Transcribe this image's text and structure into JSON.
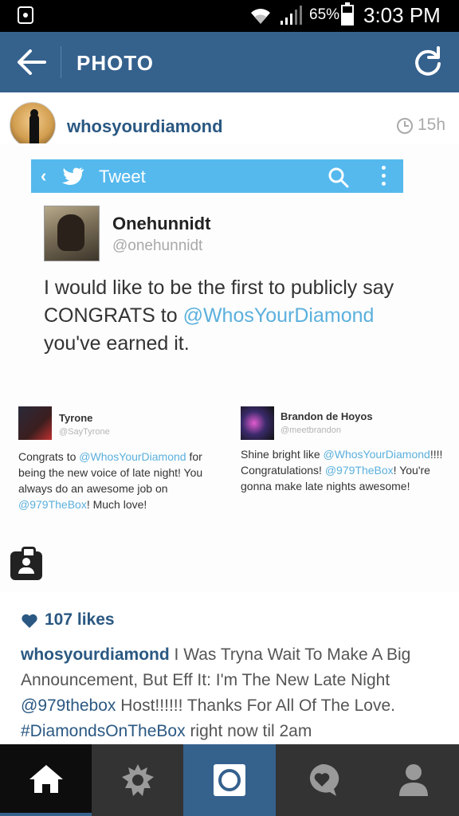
{
  "status_bar": {
    "battery_percent": "65%",
    "time": "3:03 PM",
    "icons": [
      "notification-icon",
      "wifi-icon",
      "signal-icon",
      "battery-icon"
    ]
  },
  "header": {
    "title": "PHOTO",
    "back_icon": "arrow-left-icon",
    "refresh_icon": "refresh-icon"
  },
  "post": {
    "username": "whosyourdiamond",
    "time_ago": "15h"
  },
  "photo": {
    "tweet_bar": {
      "title": "Tweet"
    },
    "tweet": {
      "name": "Onehunnidt",
      "handle": "@onehunnidt",
      "text_before": "I would like to be the first to publicly say CONGRATS to ",
      "mention": "@WhosYourDiamond",
      "text_after": " you've earned it."
    },
    "replies": [
      {
        "name": "Tyrone",
        "handle": "@SayTyrone",
        "t1": "Congrats to ",
        "m1": "@WhosYourDiamond",
        "t2": " for being the new voice of late night! You always do an awesome job on ",
        "m2": "@979TheBox",
        "t3": "! Much love!"
      },
      {
        "name": "Brandon de Hoyos",
        "handle": "@meetbrandon",
        "t1": "Shine bright like ",
        "m1": "@WhosYourDiamond",
        "t2": "!!!! Congratulations! ",
        "m2": "@979TheBox",
        "t3": "! You're gonna make late nights awesome!"
      }
    ]
  },
  "likes": {
    "text": "107 likes"
  },
  "caption": {
    "username": "whosyourdiamond",
    "text1": " I Was Tryna Wait To Make A Big Announcement, But Eff It: I'm The New Late Night ",
    "mention": "@979thebox",
    "text2": " Host!!!!!! Thanks For All Of The Love. ",
    "hashtag": "#DiamondsOnTheBox",
    "text3": " right now til 2am"
  },
  "bottom_nav": {
    "items": [
      "home-icon",
      "explore-icon",
      "camera-icon",
      "activity-icon",
      "profile-icon"
    ],
    "active": "home-icon"
  },
  "colors": {
    "brand_blue": "#35618d",
    "link_blue": "#2a5882",
    "twitter_blue": "#55b9ee",
    "mention_blue": "#5bb0dd"
  }
}
